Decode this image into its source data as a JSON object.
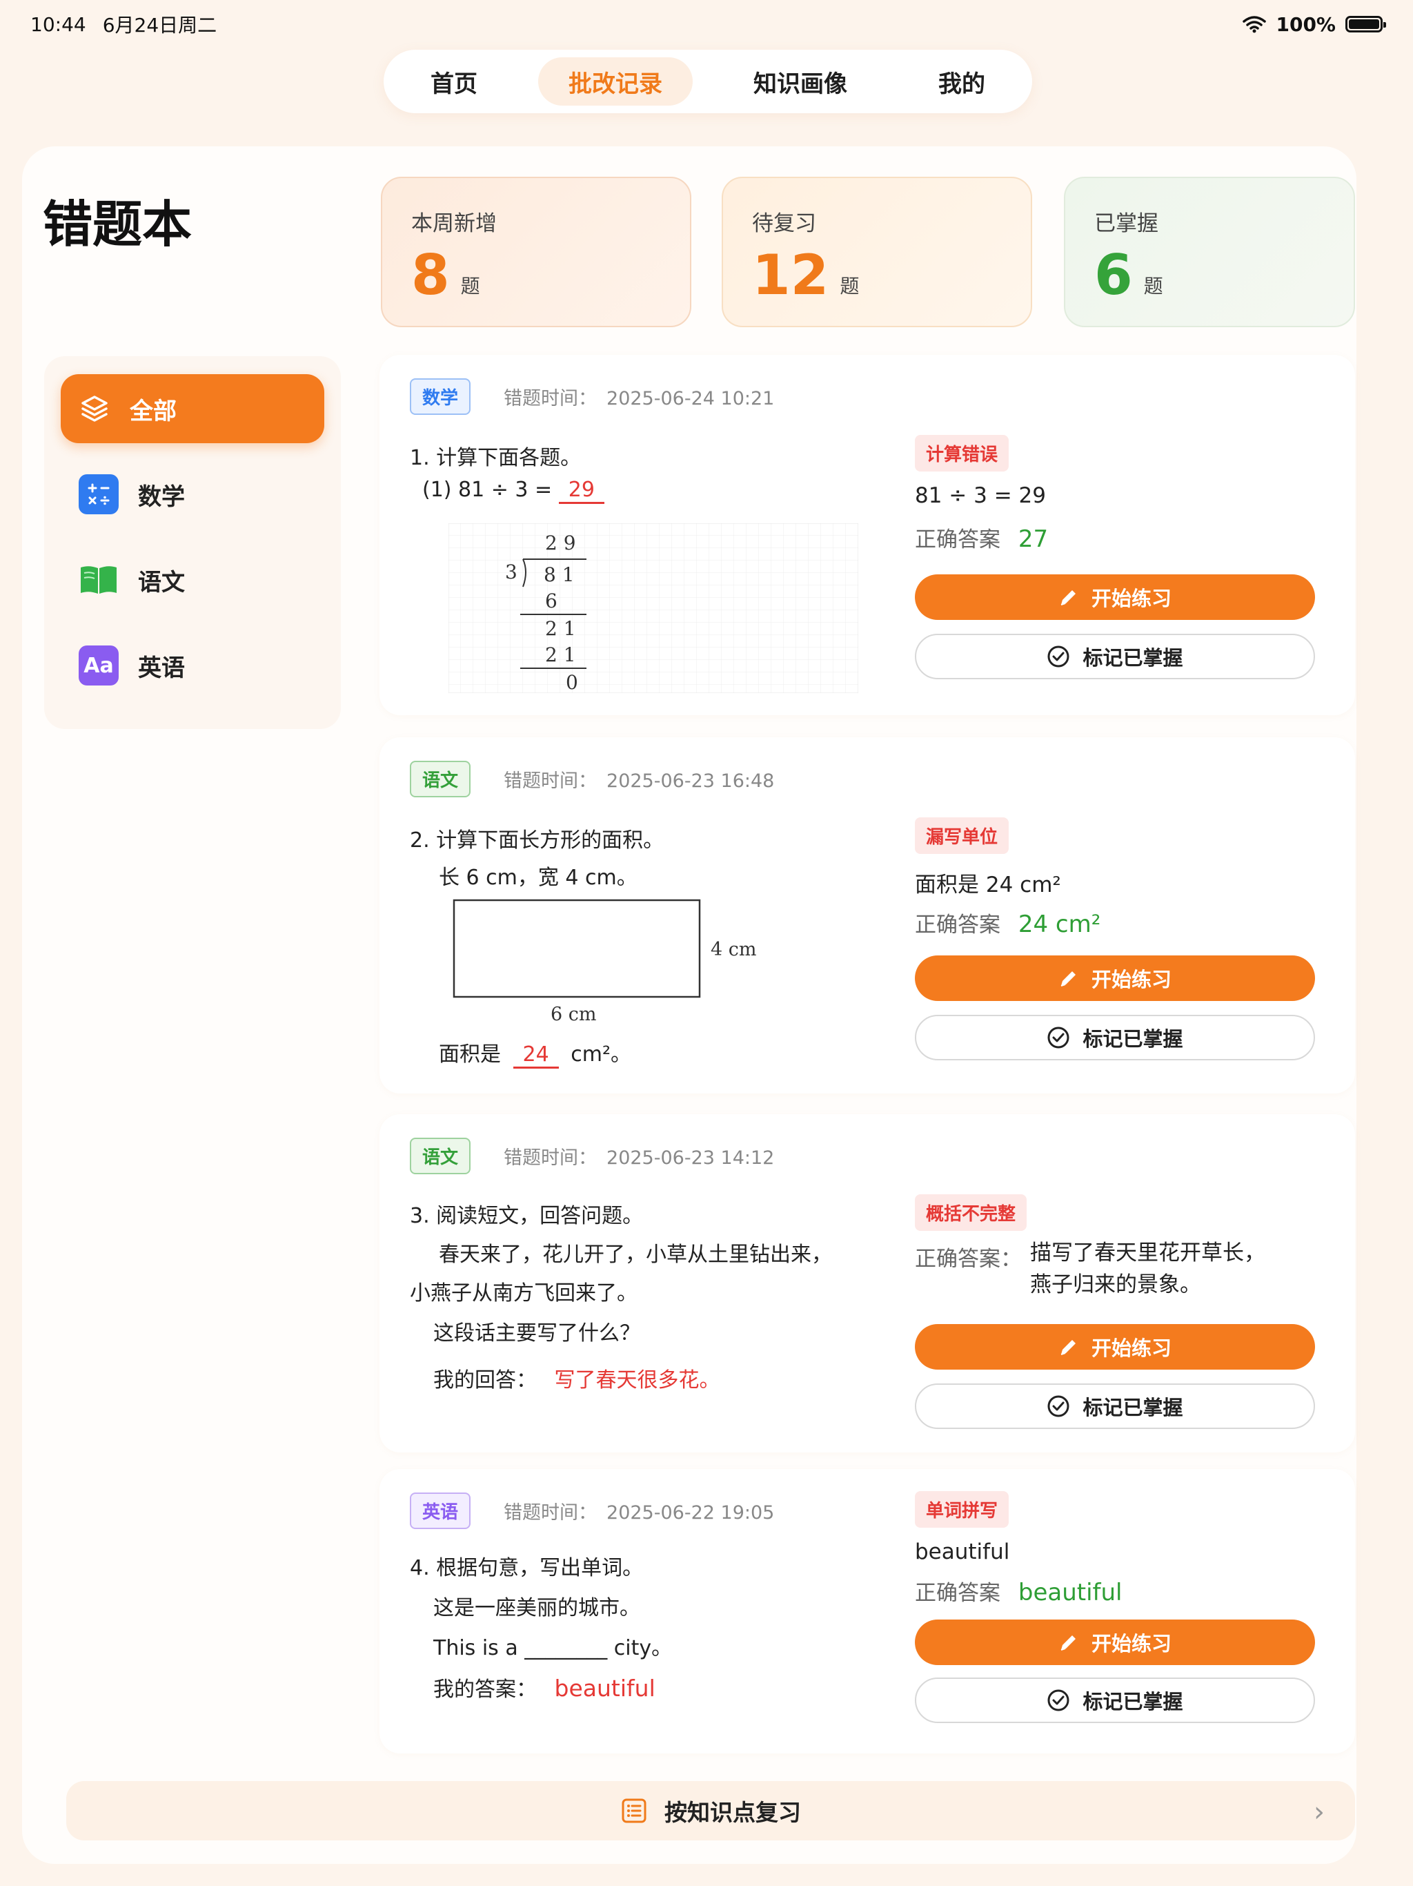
{
  "status": {
    "time": "10:44",
    "date": "6月24日周二",
    "battery": "100%",
    "battery_level": 1.0
  },
  "nav": {
    "tabs": [
      {
        "label": "首页"
      },
      {
        "label": "批改记录"
      },
      {
        "label": "知识画像"
      },
      {
        "label": "我的"
      }
    ],
    "active": "批改记录"
  },
  "page": {
    "title": "错题本"
  },
  "stats": {
    "new": {
      "label": "本周新增",
      "value": "8",
      "unit": "题"
    },
    "review": {
      "label": "待复习",
      "value": "12",
      "unit": "题"
    },
    "mastered": {
      "label": "已掌握",
      "value": "6",
      "unit": "题"
    }
  },
  "sidebar": {
    "items": [
      {
        "label": "全部",
        "icon": "layers-icon"
      },
      {
        "label": "数学",
        "icon": "calculator-icon"
      },
      {
        "label": "语文",
        "icon": "book-icon"
      },
      {
        "label": "英语",
        "icon": "aa-icon",
        "glyph": "Aa"
      }
    ]
  },
  "common": {
    "time_label": "错题时间：",
    "practice": "开始练习",
    "master": "标记已掌握",
    "answer_label": "正确答案"
  },
  "cards": [
    {
      "subject": "数学",
      "time": "2025-06-24 10:21",
      "q1": "1. 计算下面各题。",
      "q2_prefix": "(1)  81 ÷ 3 =",
      "q2_answer": "29",
      "work": {
        "quotient": "2 9",
        "divisor": "3",
        "dividend": "8 1",
        "s1": "6",
        "r1": "2 1",
        "s2": "2 1",
        "r2": "0"
      },
      "err_type": "计算错误",
      "student": "81 ÷ 3 = 29",
      "correct": "27"
    },
    {
      "subject": "语文",
      "time": "2025-06-23 16:48",
      "q1": "2. 计算下面长方形的面积。",
      "q2": "长 6 cm，宽 4 cm。",
      "rect_w_label": "6 cm",
      "rect_h_label": "4 cm",
      "ans_prefix": "面积是",
      "ans_value": "24",
      "ans_suffix": "cm²。",
      "err_type": "漏写单位",
      "student": "面积是  24 cm²",
      "correct": "24 cm²"
    },
    {
      "subject": "语文",
      "time": "2025-06-23 14:12",
      "q1": "3. 阅读短文，回答问题。",
      "p1": "春天来了，花儿开了，小草从土里钻出来，",
      "p2": "小燕子从南方飞回来了。",
      "p3": "这段话主要写了什么？",
      "ans_prefix": "我的回答：",
      "ans_value": "写了春天很多花。",
      "err_type": "概括不完整",
      "correct_label": "正确答案：",
      "correct_l1": "描写了春天里花开草长，",
      "correct_l2": "燕子归来的景象。"
    },
    {
      "subject": "英语",
      "time": "2025-06-22 19:05",
      "q1": "4. 根据句意，写出单词。",
      "q2": "这是一座美丽的城市。",
      "q3": "This is a ________ city。",
      "ans_prefix": "我的答案：",
      "ans_value": "beautiful",
      "err_type": "单词拼写",
      "student": "beautiful",
      "correct": "beautiful"
    }
  ],
  "bottom": {
    "label": "按知识点复习"
  }
}
